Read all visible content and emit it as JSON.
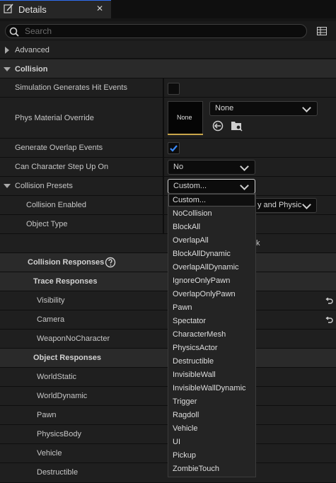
{
  "tab": {
    "title": "Details",
    "close": "✕"
  },
  "search": {
    "placeholder": "Search"
  },
  "sections": {
    "advanced": "Advanced",
    "collision": "Collision"
  },
  "props": {
    "sim_hit": "Simulation Generates Hit Events",
    "phys_material": "Phys Material Override",
    "gen_overlap": "Generate Overlap Events",
    "step_up": "Can Character Step Up On",
    "presets": "Collision Presets",
    "enabled": "Collision Enabled",
    "object_type": "Object Type",
    "responses": "Collision Responses",
    "trace_responses": "Trace Responses",
    "visibility": "Visibility",
    "camera": "Camera",
    "weapon": "WeaponNoCharacter",
    "object_responses": "Object Responses",
    "world_static": "WorldStatic",
    "world_dynamic": "WorldDynamic",
    "pawn": "Pawn",
    "physics_body": "PhysicsBody",
    "vehicle": "Vehicle",
    "destructible": "Destructible"
  },
  "values": {
    "material_thumb": "None",
    "material_combo": "None",
    "step_up": "No",
    "presets": "Custom...",
    "enabled_partial": "y and Physic",
    "object_type_partial": "k"
  },
  "states": {
    "sim_hit_checked": false,
    "gen_overlap_checked": true
  },
  "dropdown": {
    "items": [
      "Custom...",
      "NoCollision",
      "BlockAll",
      "OverlapAll",
      "BlockAllDynamic",
      "OverlapAllDynamic",
      "IgnoreOnlyPawn",
      "OverlapOnlyPawn",
      "Pawn",
      "Spectator",
      "CharacterMesh",
      "PhysicsActor",
      "Destructible",
      "InvisibleWall",
      "InvisibleWallDynamic",
      "Trigger",
      "Ragdoll",
      "Vehicle",
      "UI",
      "Pickup",
      "ZombieTouch"
    ],
    "selected": "Custom..."
  },
  "colors": {
    "accent": "#2f6ef0",
    "checkmark": "#3a8bff",
    "thumb_bar": "#c9a64a"
  }
}
